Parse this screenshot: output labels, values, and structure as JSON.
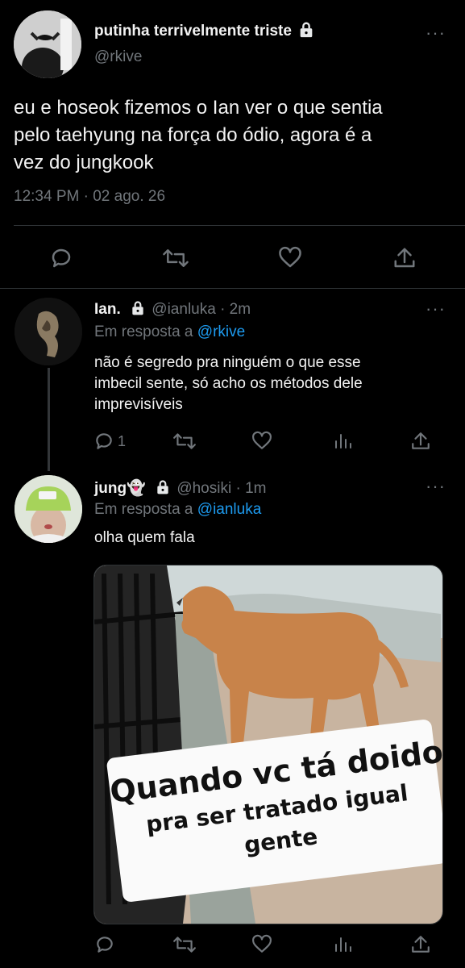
{
  "main_tweet": {
    "display_name": "putinha terrivelmente triste",
    "handle": "@rkive",
    "text_lines": [
      "eu e hoseok fizemos o Ian ver o que sentia",
      "pelo taehyung na força do ódio, agora é a",
      "vez do jungkook"
    ],
    "timestamp": "12:34 PM · 02 ago. 26"
  },
  "reply1": {
    "display_name": "Ian.",
    "handle": "@ianluka",
    "time": "· 2m",
    "reply_prefix": "Em resposta a",
    "reply_to": "@rkive",
    "text_lines": [
      "não é segredo pra ninguém o que esse",
      "imbecil sente, só acho os métodos dele",
      "imprevisíveis"
    ],
    "reply_count": "1"
  },
  "reply2": {
    "display_name": "jung👻",
    "handle": "@hosiki",
    "time": "· 1m",
    "reply_prefix": "Em resposta a",
    "reply_to": "@ianluka",
    "text": "olha quem fala",
    "meme_caption_lines": [
      "Quando vc tá doido",
      "pra ser tratado igual",
      "gente"
    ]
  },
  "icons": [
    "more-icon",
    "lock-icon",
    "reply-icon",
    "retweet-icon",
    "like-icon",
    "share-icon",
    "analytics-icon"
  ],
  "colors": {
    "background": "#000000",
    "text": "#e7e9ea",
    "muted": "#71767b",
    "link": "#1d9bf0",
    "divider": "#2f3336"
  }
}
